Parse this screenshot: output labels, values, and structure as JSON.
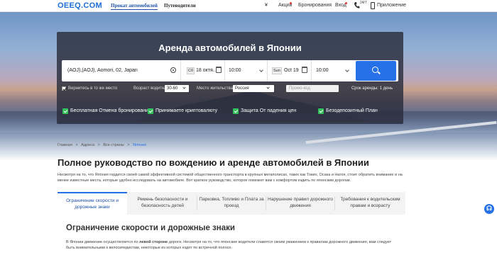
{
  "nav": {
    "logo": "OEEQ.COM",
    "links": [
      "Прокат автомобилей",
      "Путеводители"
    ],
    "currency": "¥",
    "promos": "Акции",
    "bookings": "Бронирования",
    "login": "Вход",
    "support_badge": "24/7",
    "app": "Приложение"
  },
  "search": {
    "title": "Аренда автомобилей в Японии",
    "location": "(AOJ),(AOJ), Aomori, 02, Japan",
    "pickup_day": "Сб",
    "pickup_date": "18 октя...",
    "pickup_time": "10:00",
    "return_day": "Sun",
    "return_date": "Oct 19",
    "return_time": "10:00",
    "return_same_place": "Вернитесь в то же место",
    "driver_age_label": "Возраст водителя:",
    "driver_age_value": "30-60",
    "residence_label": "Место жительства:",
    "residence_value": "Россия",
    "promo_placeholder": "Промо-код",
    "min_rental": "Срок аренды: 1 день",
    "features": [
      "Бесплатная Отмена бронирования",
      "Принимаете криптовалюту",
      "Защита От падения цен",
      "Безодепозитный План"
    ]
  },
  "breadcrumb": [
    "Главная",
    ">",
    "Адреса",
    ">",
    "Все страны",
    ">",
    "Япония"
  ],
  "page": {
    "title": "Полное руководство по вождению и аренде автомобилей в Японии",
    "intro": "Несмотря на то, что Япония гордится своей самой эффективной системой общественного транспорта в крупных мегаполисах, таких как Токио, Осака и Нагоя, стоит обратить внимание и на менее известные места, которые удобно исследовать на автомобиле. Вот краткое руководство, которое поможет вам с комфортом ездить по японским дорогам.",
    "tabs": [
      "Ограничение скорости и дорожные знаки",
      "Ремень безопасности и безопасность детей",
      "Парковка, Топливо и Плата за проезд",
      "Нарушение правил дорожного движения",
      "Требования к водительским правам и возрасту"
    ],
    "section_title": "Ограничение скорости и дорожные знаки",
    "section_text_a": "В Японии движение осуществляется по ",
    "section_text_bold": "левой стороне",
    "section_text_b": " дороги. Несмотря на то, что японские водители славятся своим уважением к правилам дорожного движения, вам следует быть внимательными к велосипедистам, некоторые из которых ездят по встречной полосе."
  },
  "colors": {
    "accent": "#2670e8",
    "feature_check": "#34c05a"
  }
}
